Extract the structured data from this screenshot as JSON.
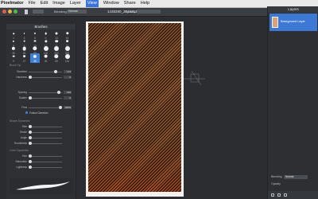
{
  "menubar": {
    "app": "Pixelmator",
    "items": [
      "File",
      "Edit",
      "Image",
      "Layer",
      "View",
      "Window",
      "Share",
      "Help"
    ],
    "active": "View"
  },
  "toolbar": {
    "blending_label": "Blending",
    "blending_value": "Normal",
    "opacity_label": "Opacity",
    "doc_title": "1438280_25482136",
    "doc_status": "Edited"
  },
  "brushes": {
    "title": "Brushes",
    "sizes": [
      "1",
      "3",
      "5",
      "9",
      "13",
      "19",
      "5",
      "9",
      "13",
      "17",
      "21",
      "27",
      "35",
      "45",
      "65",
      "100",
      "200",
      "300",
      "9",
      "27",
      "35",
      "45",
      "65",
      "100"
    ],
    "selected": 20
  },
  "brush_tip": {
    "section": "Brush Tip",
    "diameter_label": "Diameter",
    "diameter_value": "172",
    "hardness_label": "Hardness",
    "hardness_value": "0",
    "spacing_label": "Spacing",
    "spacing_value": "156",
    "scatter_label": "Scatter",
    "scatter_value": "0",
    "flow_label": "Flow",
    "flow_value": "100%",
    "follow_direction": "Follow Direction"
  },
  "shape_dynamics": {
    "section": "Shape Dynamics",
    "size_label": "Size",
    "stroke_label": "Stroke",
    "angle_label": "Angle",
    "roundness_label": "Roundness"
  },
  "color_dynamics": {
    "section": "Color Dynamics",
    "hue_label": "Hue",
    "saturation_label": "Saturation",
    "lightness_label": "Lightness"
  },
  "layers": {
    "title": "Layers",
    "layer_name": "Background Layer",
    "blending_label": "Blending",
    "blending_value": "Normal",
    "opacity_label": "Opacity"
  },
  "colors": {
    "accent": "#3f7fd6",
    "panel": "#2e3034"
  }
}
